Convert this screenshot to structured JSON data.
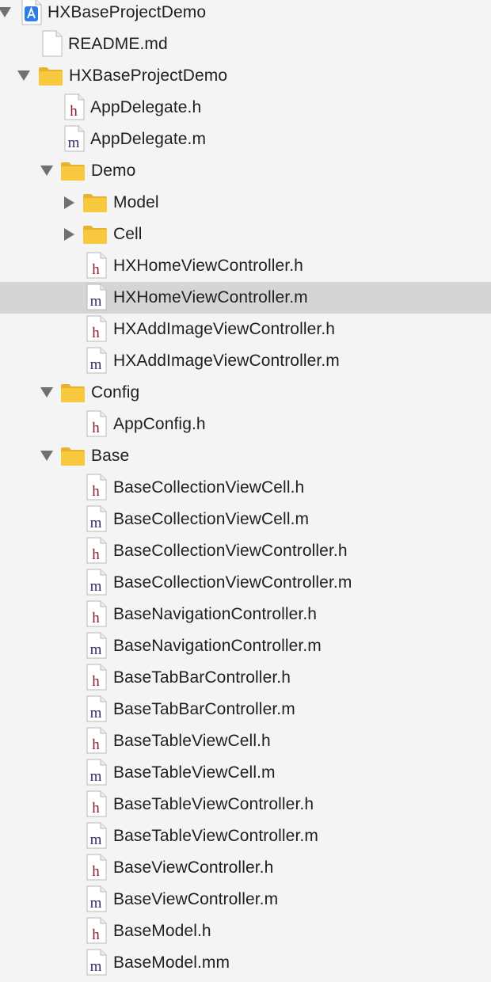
{
  "navigator": {
    "items": [
      {
        "label": "HXBaseProjectDemo",
        "type": "project",
        "disclosure": "expanded"
      },
      {
        "label": "README.md",
        "type": "file",
        "disclosure": "none"
      },
      {
        "label": "HXBaseProjectDemo",
        "type": "folder",
        "disclosure": "expanded"
      },
      {
        "label": "AppDelegate.h",
        "type": "header",
        "disclosure": "none",
        "icon_letter": "h"
      },
      {
        "label": "AppDelegate.m",
        "type": "implementation",
        "disclosure": "none",
        "icon_letter": "m"
      },
      {
        "label": "Demo",
        "type": "folder",
        "disclosure": "expanded"
      },
      {
        "label": "Model",
        "type": "folder",
        "disclosure": "collapsed"
      },
      {
        "label": "Cell",
        "type": "folder",
        "disclosure": "collapsed"
      },
      {
        "label": "HXHomeViewController.h",
        "type": "header",
        "disclosure": "none",
        "icon_letter": "h"
      },
      {
        "label": "HXHomeViewController.m",
        "type": "implementation",
        "disclosure": "none",
        "icon_letter": "m",
        "selected": true
      },
      {
        "label": "HXAddImageViewController.h",
        "type": "header",
        "disclosure": "none",
        "icon_letter": "h"
      },
      {
        "label": "HXAddImageViewController.m",
        "type": "implementation",
        "disclosure": "none",
        "icon_letter": "m"
      },
      {
        "label": "Config",
        "type": "folder",
        "disclosure": "expanded"
      },
      {
        "label": "AppConfig.h",
        "type": "header",
        "disclosure": "none",
        "icon_letter": "h"
      },
      {
        "label": "Base",
        "type": "folder",
        "disclosure": "expanded"
      },
      {
        "label": "BaseCollectionViewCell.h",
        "type": "header",
        "disclosure": "none",
        "icon_letter": "h"
      },
      {
        "label": "BaseCollectionViewCell.m",
        "type": "implementation",
        "disclosure": "none",
        "icon_letter": "m"
      },
      {
        "label": "BaseCollectionViewController.h",
        "type": "header",
        "disclosure": "none",
        "icon_letter": "h"
      },
      {
        "label": "BaseCollectionViewController.m",
        "type": "implementation",
        "disclosure": "none",
        "icon_letter": "m"
      },
      {
        "label": "BaseNavigationController.h",
        "type": "header",
        "disclosure": "none",
        "icon_letter": "h"
      },
      {
        "label": "BaseNavigationController.m",
        "type": "implementation",
        "disclosure": "none",
        "icon_letter": "m"
      },
      {
        "label": "BaseTabBarController.h",
        "type": "header",
        "disclosure": "none",
        "icon_letter": "h"
      },
      {
        "label": "BaseTabBarController.m",
        "type": "implementation",
        "disclosure": "none",
        "icon_letter": "m"
      },
      {
        "label": "BaseTableViewCell.h",
        "type": "header",
        "disclosure": "none",
        "icon_letter": "h"
      },
      {
        "label": "BaseTableViewCell.m",
        "type": "implementation",
        "disclosure": "none",
        "icon_letter": "m"
      },
      {
        "label": "BaseTableViewController.h",
        "type": "header",
        "disclosure": "none",
        "icon_letter": "h"
      },
      {
        "label": "BaseTableViewController.m",
        "type": "implementation",
        "disclosure": "none",
        "icon_letter": "m"
      },
      {
        "label": "BaseViewController.h",
        "type": "header",
        "disclosure": "none",
        "icon_letter": "h"
      },
      {
        "label": "BaseViewController.m",
        "type": "implementation",
        "disclosure": "none",
        "icon_letter": "m"
      },
      {
        "label": "BaseModel.h",
        "type": "header",
        "disclosure": "none",
        "icon_letter": "h"
      },
      {
        "label": "BaseModel.mm",
        "type": "implementation",
        "disclosure": "none",
        "icon_letter": "m"
      }
    ]
  },
  "colors": {
    "background": "#f4f4f4",
    "selection": "#d5d5d5",
    "folder": "#f8c93f",
    "header_letter": "#8a1a2c",
    "implementation_letter": "#3a2a6a",
    "project_icon": "#2e7ee6"
  }
}
